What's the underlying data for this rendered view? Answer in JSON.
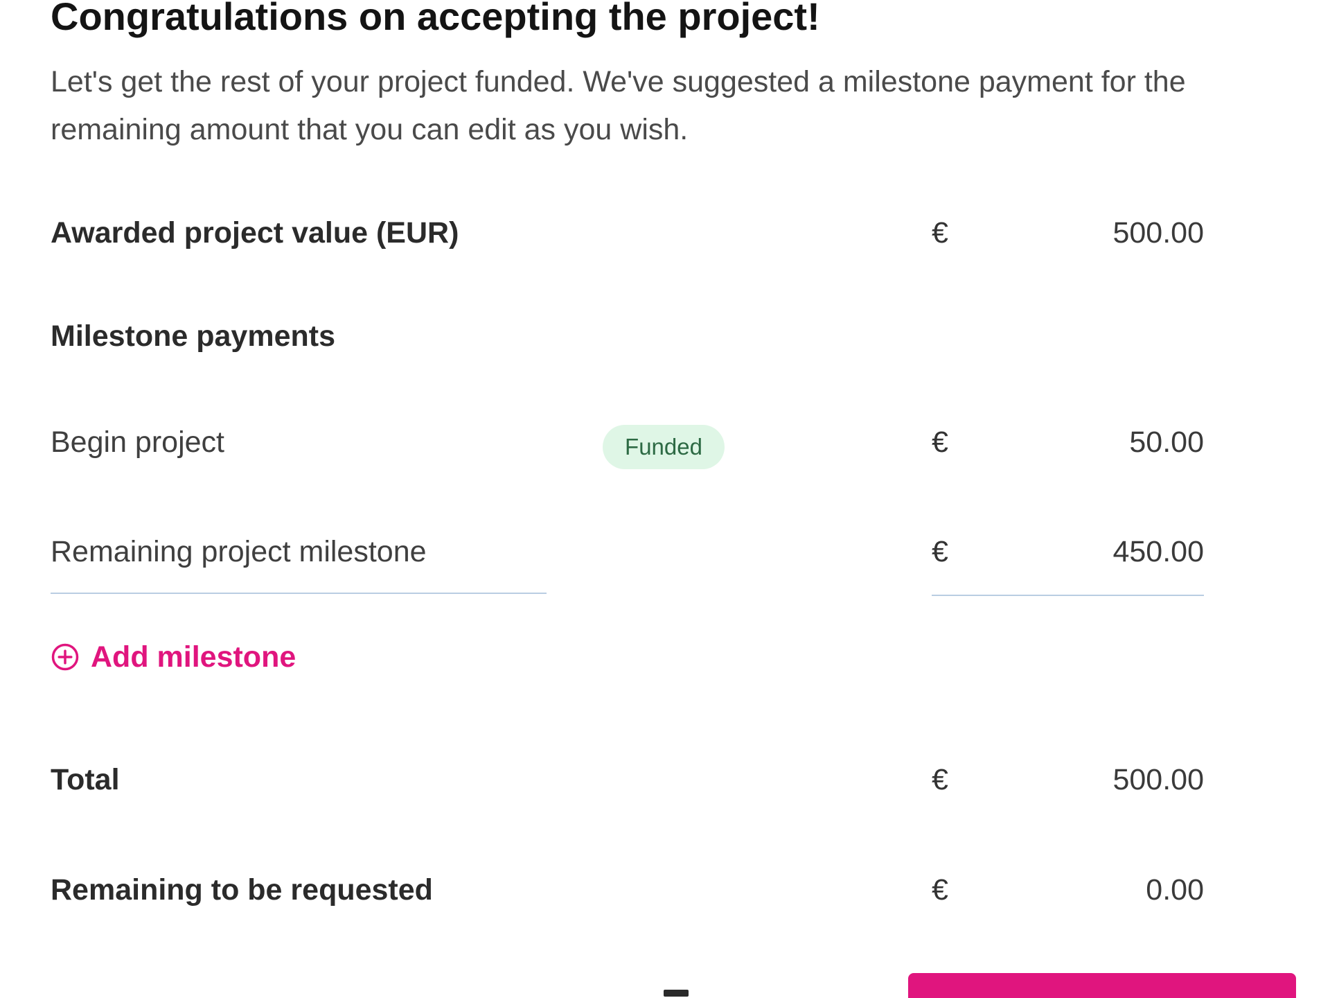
{
  "header": {
    "title": "Congratulations on accepting the project!",
    "subtitle": "Let's get the rest of your project funded. We've suggested a milestone payment for the remaining amount that you can edit as you wish."
  },
  "awarded": {
    "label": "Awarded project value (EUR)",
    "currency": "€",
    "amount": "500.00"
  },
  "milestones": {
    "heading": "Milestone payments",
    "items": [
      {
        "label": "Begin project",
        "status": "Funded",
        "currency": "€",
        "amount": "50.00"
      },
      {
        "label": "Remaining project milestone",
        "currency": "€",
        "amount": "450.00"
      }
    ],
    "add_label": "Add milestone",
    "add_icon": "plus-circle-icon"
  },
  "totals": {
    "total_label": "Total",
    "total_currency": "€",
    "total_amount": "500.00",
    "remaining_label": "Remaining to be requested",
    "remaining_currency": "€",
    "remaining_amount": "0.00"
  },
  "colors": {
    "accent": "#e0157e",
    "funded_bg": "#dff6e6",
    "funded_text": "#2d6a44",
    "input_underline": "#b9cde2"
  }
}
